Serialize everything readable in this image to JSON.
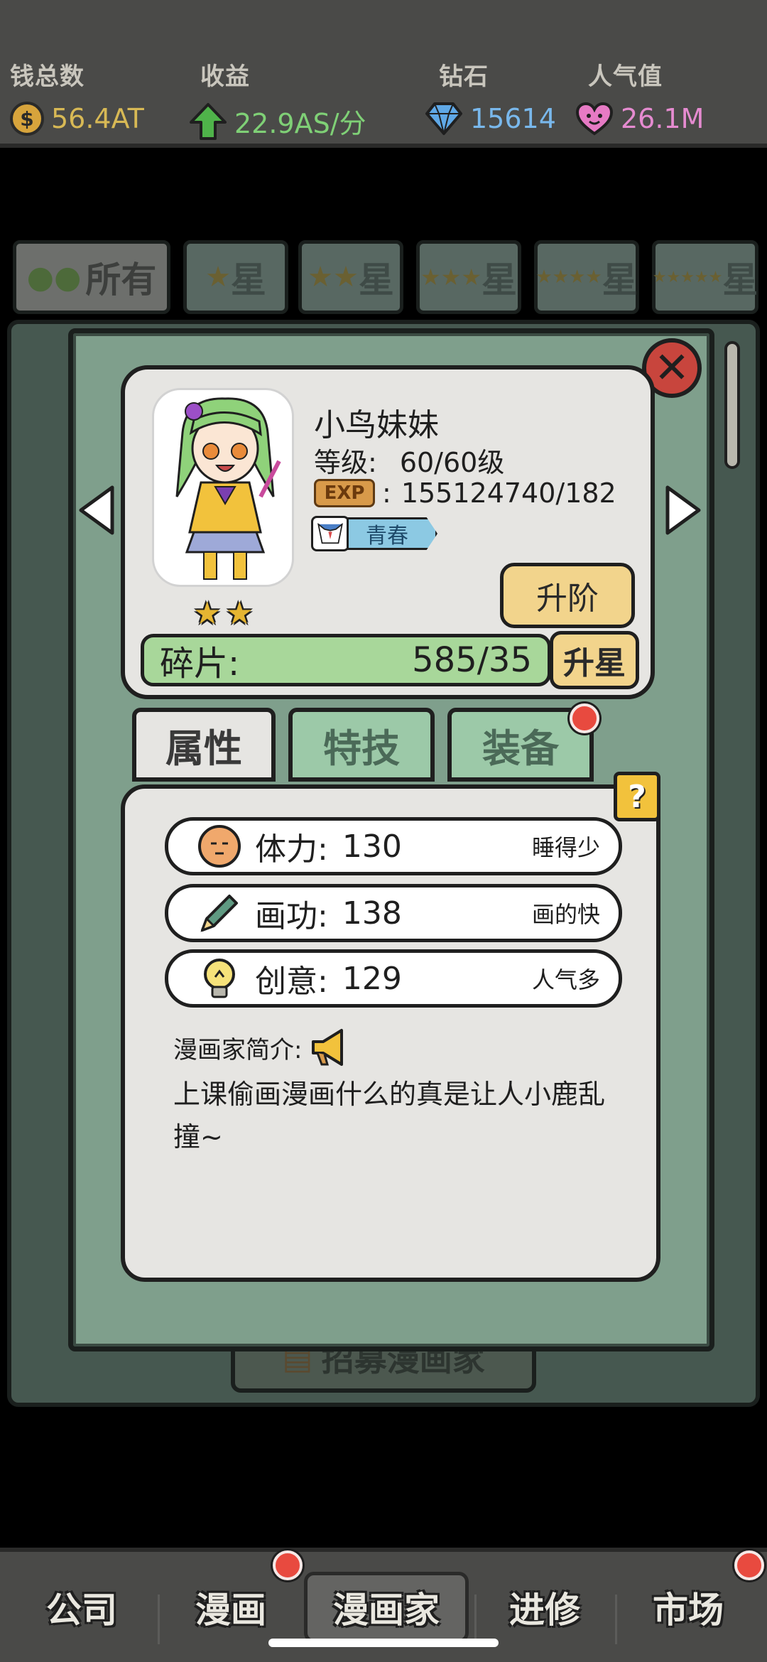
{
  "top_bar": {
    "money": {
      "label": "钱总数",
      "value": "56.4AT",
      "icon": "coin-icon"
    },
    "income": {
      "label": "收益",
      "value": "22.9AS/分",
      "icon": "up-arrow-icon"
    },
    "diamonds": {
      "label": "钻石",
      "value": "15614",
      "icon": "diamond-icon"
    },
    "popularity": {
      "label": "人气值",
      "value": "26.1M",
      "icon": "heart-icon"
    }
  },
  "filter_tabs": [
    {
      "label": "所有",
      "stars": 0
    },
    {
      "label": "星",
      "stars": 1
    },
    {
      "label": "星",
      "stars": 2
    },
    {
      "label": "星",
      "stars": 3
    },
    {
      "label": "星",
      "stars": 4
    },
    {
      "label": "星",
      "stars": 5
    }
  ],
  "recruit_label": "招募漫画家",
  "artist": {
    "name": "小鸟妹妹",
    "level_label": "等级:",
    "level_value": "60/60级",
    "exp_badge": "EXP",
    "exp_value": "155124740/182",
    "tag": "青春",
    "star_count": 2,
    "upgrade_label": "升阶",
    "shards_label": "碎片:",
    "shards_value": "585/35",
    "star_up_label": "升星"
  },
  "tabs": [
    {
      "label": "属性",
      "active": true,
      "badge": false
    },
    {
      "label": "特技",
      "active": false,
      "badge": false
    },
    {
      "label": "装备",
      "active": false,
      "badge": true
    }
  ],
  "help_label": "?",
  "attributes": [
    {
      "name": "体力:",
      "value": "130",
      "desc": "睡得少",
      "icon": "face-icon"
    },
    {
      "name": "画功:",
      "value": "138",
      "desc": "画的快",
      "icon": "pencil-icon"
    },
    {
      "name": "创意:",
      "value": "129",
      "desc": "人气多",
      "icon": "lightbulb-icon"
    }
  ],
  "intro": {
    "label": "漫画家简介:",
    "text": "上课偷画漫画什么的真是让人小鹿乱撞~"
  },
  "bottom_nav": [
    {
      "label": "公司",
      "active": false,
      "badge": false
    },
    {
      "label": "漫画",
      "active": false,
      "badge": true
    },
    {
      "label": "漫画家",
      "active": true,
      "badge": false
    },
    {
      "label": "进修",
      "active": false,
      "badge": false
    },
    {
      "label": "市场",
      "active": false,
      "badge": true
    }
  ],
  "colors": {
    "modal_bg": "#7f9f8c",
    "card_bg": "#e6e5e2",
    "shard_bar": "#a8d79a",
    "button_yellow": "#f2d48c",
    "badge_red": "#e84a3f",
    "tag_blue": "#8cc9e3",
    "star_gold": "#e5b532"
  }
}
